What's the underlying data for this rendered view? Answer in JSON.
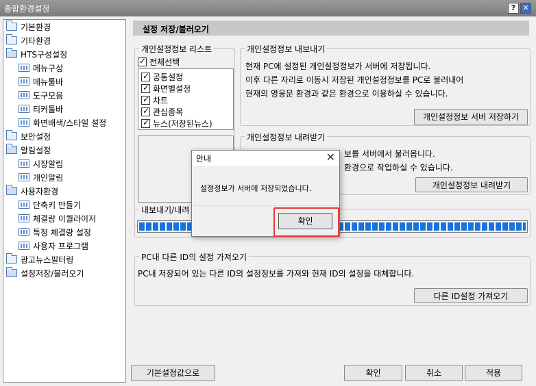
{
  "window": {
    "title": "종합환경설정",
    "help_glyph": "?",
    "close_glyph": "✕"
  },
  "tree": {
    "items": [
      {
        "label": "기본환경",
        "icon": "folder-icon"
      },
      {
        "label": "기타환경",
        "icon": "folder-icon"
      },
      {
        "label": "HTS구성설정",
        "icon": "folder-open-icon"
      },
      {
        "label": "메뉴구성",
        "icon": "grid-page-icon"
      },
      {
        "label": "메뉴툴바",
        "icon": "grid-page-icon"
      },
      {
        "label": "도구모음",
        "icon": "grid-page-icon"
      },
      {
        "label": "티커툴바",
        "icon": "grid-page-icon"
      },
      {
        "label": "화면배색/스타일 설정",
        "icon": "grid-page-icon"
      },
      {
        "label": "보안설정",
        "icon": "folder-icon"
      },
      {
        "label": "알림설정",
        "icon": "folder-open-icon"
      },
      {
        "label": "시장알림",
        "icon": "grid-page-icon"
      },
      {
        "label": "개인알림",
        "icon": "grid-page-icon"
      },
      {
        "label": "사용자환경",
        "icon": "folder-open-icon"
      },
      {
        "label": "단축키 만들기",
        "icon": "grid-page-icon"
      },
      {
        "label": "체결량 이퀄라이저",
        "icon": "grid-page-icon"
      },
      {
        "label": "특정 체결량 설정",
        "icon": "grid-page-icon"
      },
      {
        "label": "사용자 프로그램",
        "icon": "grid-page-icon"
      },
      {
        "label": "광고뉴스필터링",
        "icon": "folder-icon"
      },
      {
        "label": "설정저장/불러오기",
        "icon": "folder-open-icon"
      }
    ]
  },
  "main": {
    "header": "설정 저장/불러오기",
    "list_group": {
      "title": "개인설정정보 리스트",
      "select_all": "전체선택",
      "items": [
        "공통설정",
        "화면별설정",
        "차트",
        "관심종목",
        "뉴스(저장된뉴스)"
      ]
    },
    "export_group": {
      "title": "개인설정정보 내보내기",
      "lines": [
        "현재 PC에 설정된 개인설정정보가 서버에 저장됩니다.",
        "이후 다른 자리로 이동시 저장된 개인설정정보를 PC로 불러내어",
        "현재의 영웅문 환경과 같은 환경으로 이용하실 수 있습니다."
      ],
      "button": "개인설정정보 서버 저장하기"
    },
    "import_group": {
      "title": "개인설정정보 내려받기",
      "line1": "보를 서버에서 불러옵니다.",
      "line2": "환경으로 작업하실 수 있습니다.",
      "button": "개인설정정보 내려받기"
    },
    "progress_group": {
      "title": "내보내기/내려",
      "progress": 1.0
    },
    "other_id_group": {
      "title": "PC내 다른 ID의 설정 가져오기",
      "line": "PC내 저장되어 있는 다른 ID의 설정정보를 가져와 현재 ID의 설정을 대체합니다.",
      "button": "다른 ID설정 가져오기"
    },
    "footer": {
      "default": "기본설정값으로",
      "ok": "확인",
      "cancel": "취소",
      "apply": "적용"
    }
  },
  "dialog": {
    "title": "안내",
    "close_glyph": "✕",
    "message": "설정정보가 서버에 저장되었습니다.",
    "ok": "확인"
  },
  "colors": {
    "highlight": "#e53935",
    "progress": "#1973db",
    "titlebar": "#8a8a8a"
  }
}
